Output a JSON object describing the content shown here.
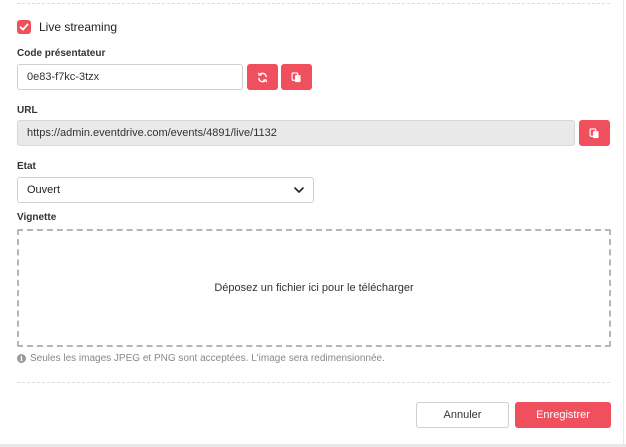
{
  "live": {
    "checkbox_label": "Live streaming",
    "checked": true
  },
  "presenter": {
    "label": "Code présentateur",
    "value": "0e83-f7kc-3tzx"
  },
  "url": {
    "label": "URL",
    "value": "https://admin.eventdrive.com/events/4891/live/1132"
  },
  "state": {
    "label": "Etat",
    "selected": "Ouvert"
  },
  "thumbnail": {
    "label": "Vignette",
    "dropzone_text": "Déposez un fichier ici pour le télécharger",
    "help_text": "Seules les images JPEG et PNG sont acceptées. L'image sera redimensionnée."
  },
  "actions": {
    "cancel_label": "Annuler",
    "save_label": "Enregistrer"
  },
  "colors": {
    "accent": "#f0505e",
    "readonly_bg": "#e9e9e9"
  },
  "icons": {
    "refresh": "refresh-icon",
    "copy": "copy-icon",
    "check": "check-icon",
    "chevron": "chevron-down-icon",
    "info": "info-icon"
  }
}
